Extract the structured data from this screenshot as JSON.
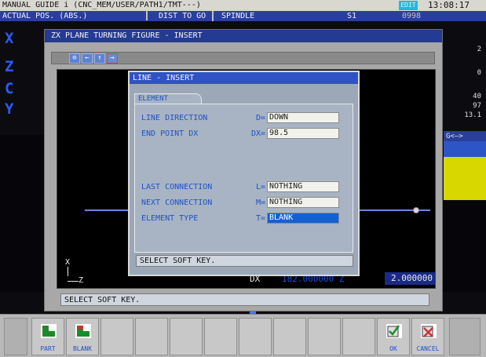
{
  "topbar": {
    "title": "MANUAL GUIDE i (CNC_MEM/USER/PATH1/TMT---)",
    "mode": "EDIT",
    "time": "13:08:17"
  },
  "posbar": {
    "actual_pos": "ACTUAL POS. (ABS.)",
    "dist_to_go": "DIST TO GO",
    "spindle": "SPINDLE",
    "spindle_id": "S1",
    "program_number": "0998"
  },
  "background": {
    "axes": [
      "X",
      "Z",
      "C",
      "Y"
    ],
    "right_values": [
      "2",
      "0",
      "40",
      "97",
      "13.1"
    ],
    "g_label": "G<—>"
  },
  "main_window": {
    "title": "ZX PLANE TURNING FIGURE - INSERT",
    "dx_label": "DX",
    "dx_value": "182.000000 Z",
    "z_value": "2.000000",
    "axis_x": "X",
    "axis_z": "Z",
    "message": "SELECT SOFT KEY."
  },
  "dialog": {
    "title": "LINE - INSERT",
    "tab_label": "ELEMENT",
    "fields": [
      {
        "label": "LINE DIRECTION",
        "key": "D=",
        "value": "DOWN",
        "selected": false
      },
      {
        "label": "END POINT DX",
        "key": "DX=",
        "value": "98.5",
        "selected": false
      },
      {
        "label": "LAST CONNECTION",
        "key": "L=",
        "value": "NOTHING",
        "selected": false
      },
      {
        "label": "NEXT CONNECTION",
        "key": "M=",
        "value": "NOTHING",
        "selected": false
      },
      {
        "label": "ELEMENT TYPE",
        "key": "T=",
        "value": "BLANK",
        "selected": true
      }
    ],
    "message": "SELECT SOFT KEY."
  },
  "softkeys": [
    {
      "label": "PART"
    },
    {
      "label": "BLANK"
    },
    {
      "label": ""
    },
    {
      "label": ""
    },
    {
      "label": ""
    },
    {
      "label": ""
    },
    {
      "label": ""
    },
    {
      "label": ""
    },
    {
      "label": ""
    },
    {
      "label": ""
    },
    {
      "label": "OK"
    },
    {
      "label": "CANCEL"
    }
  ],
  "colors": {
    "title_blue": "#243a93",
    "dialog_title_blue": "#2f53c4",
    "field_label_blue": "#1f52c8",
    "selected_field": "#1560d0",
    "mode_cyan": "#1fb8e0"
  }
}
